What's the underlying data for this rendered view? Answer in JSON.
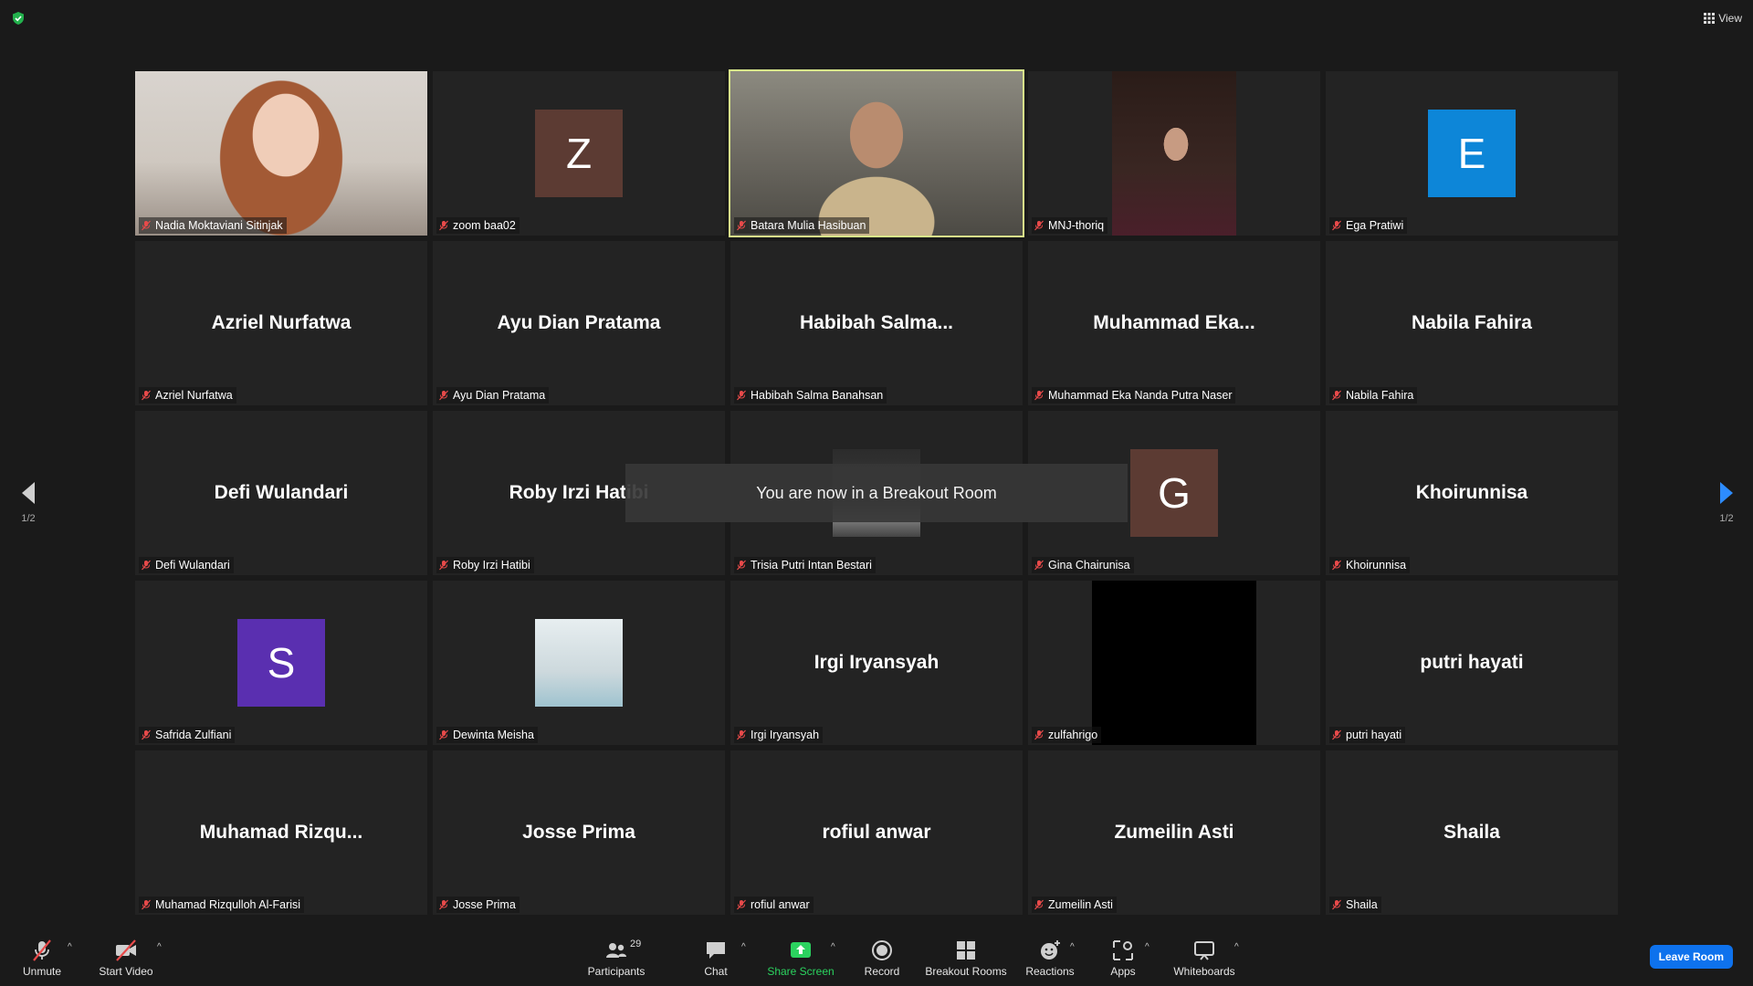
{
  "top": {
    "view_label": "View"
  },
  "colors": {
    "active_border": "#d8e88a",
    "leave_bg": "#0e72ed",
    "share_green": "#2bd35f",
    "mic_off": "#e84a4a"
  },
  "tiles": [
    {
      "label": "Nadia Moktaviani Sitinjak",
      "video": "nadia"
    },
    {
      "label": "zoom baa02",
      "avatar": "Z",
      "avatar_color": "#5c3b33"
    },
    {
      "label": "Batara Mulia Hasibuan",
      "video": "batara",
      "active": true
    },
    {
      "label": "MNJ-thoriq",
      "video": "thoriq"
    },
    {
      "label": "Ega Pratiwi",
      "avatar": "E",
      "avatar_color": "#0d86d8"
    },
    {
      "label": "Azriel Nurfatwa",
      "big": "Azriel Nurfatwa"
    },
    {
      "label": "Ayu Dian Pratama",
      "big": "Ayu Dian Pratama"
    },
    {
      "label": "Habibah Salma Banahsan",
      "big": "Habibah  Salma..."
    },
    {
      "label": "Muhammad Eka Nanda Putra Naser",
      "big": "Muhammad  Eka..."
    },
    {
      "label": "Nabila Fahira",
      "big": "Nabila Fahira"
    },
    {
      "label": "Defi Wulandari",
      "big": "Defi Wulandari"
    },
    {
      "label": "Roby Irzi Hatibi",
      "big": "Roby Irzi Hatibi"
    },
    {
      "label": "Trisia Putri Intan Bestari",
      "video": "trisia"
    },
    {
      "label": "Gina Chairunisa",
      "avatar": "G",
      "avatar_color": "#5c3b33"
    },
    {
      "label": "Khoirunnisa",
      "big": "Khoirunnisa"
    },
    {
      "label": "Safrida Zulfiani",
      "avatar": "S",
      "avatar_color": "#5a2fb0"
    },
    {
      "label": "Dewinta Meisha",
      "video": "dewinta"
    },
    {
      "label": "Irgi Iryansyah",
      "big": "Irgi Iryansyah"
    },
    {
      "label": "zulfahrigo",
      "video": "zulfa"
    },
    {
      "label": "putri hayati",
      "big": "putri hayati"
    },
    {
      "label": "Muhamad Rizqulloh Al-Farisi",
      "big": "Muhamad  Rizqu..."
    },
    {
      "label": "Josse Prima",
      "big": "Josse Prima"
    },
    {
      "label": "rofiul anwar",
      "big": "rofiul anwar"
    },
    {
      "label": "Zumeilin Asti",
      "big": "Zumeilin Asti"
    },
    {
      "label": "Shaila",
      "big": "Shaila"
    }
  ],
  "toast": "You are now in a Breakout Room",
  "pagination": {
    "left": "1/2",
    "right": "1/2"
  },
  "toolbar": {
    "unmute": "Unmute",
    "start_video": "Start Video",
    "participants": "Participants",
    "participant_count": "29",
    "chat": "Chat",
    "share_screen": "Share Screen",
    "record": "Record",
    "breakout_rooms": "Breakout Rooms",
    "reactions": "Reactions",
    "apps": "Apps",
    "whiteboards": "Whiteboards",
    "leave": "Leave Room"
  }
}
